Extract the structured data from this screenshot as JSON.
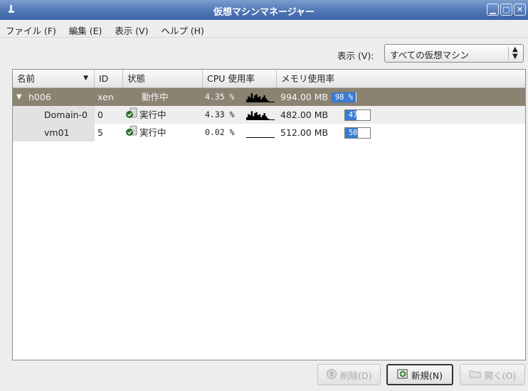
{
  "window": {
    "title": "仮想マシンマネージャー"
  },
  "menus": [
    "ファイル (F)",
    "編集 (E)",
    "表示 (V)",
    "ヘルプ (H)"
  ],
  "filter": {
    "label": "表示 (V):",
    "selected": "すべての仮想マシン"
  },
  "columns": {
    "name": "名前",
    "id": "ID",
    "state": "状態",
    "cpu": "CPU 使用率",
    "memory": "メモリ使用率"
  },
  "host": {
    "name": "h006",
    "id": "xen",
    "state": "動作中",
    "cpu": "4.35 %",
    "memory": "994.00 MB",
    "mem_pct_label": "98 %",
    "mem_pct": 98,
    "cpu_history": [
      0.3,
      0.6,
      0.5,
      0.9,
      0.4,
      0.7,
      0.8,
      0.5,
      0.6,
      0.3,
      0.5,
      0.7,
      0.4,
      0.2,
      0.1,
      0.05,
      0.05,
      0.05
    ]
  },
  "vms": [
    {
      "name": "Domain-0",
      "id": "0",
      "state": "実行中",
      "cpu": "4.33 %",
      "memory": "482.00 MB",
      "mem_pct_label": "47 %",
      "mem_pct": 47,
      "cpu_history": [
        0.3,
        0.6,
        0.5,
        0.9,
        0.4,
        0.7,
        0.8,
        0.5,
        0.6,
        0.3,
        0.5,
        0.7,
        0.4,
        0.2,
        0.1,
        0.05,
        0.05,
        0.05
      ]
    },
    {
      "name": "vm01",
      "id": "5",
      "state": "実行中",
      "cpu": "0.02 %",
      "memory": "512.00 MB",
      "mem_pct_label": "50 %",
      "mem_pct": 50,
      "cpu_history": [
        0.02,
        0.02,
        0.02,
        0.02,
        0.02,
        0.02,
        0.02,
        0.02,
        0.02,
        0.02,
        0.02,
        0.02,
        0.02,
        0.02,
        0.02,
        0.02,
        0.02,
        0.02
      ]
    }
  ],
  "buttons": {
    "delete": "削除(D)",
    "new": "新規(N)",
    "open": "開く(O)"
  },
  "colors": {
    "titlebar": "#5076b5",
    "host_row": "#8b8272",
    "memory_fill": "#3a7cd2"
  }
}
